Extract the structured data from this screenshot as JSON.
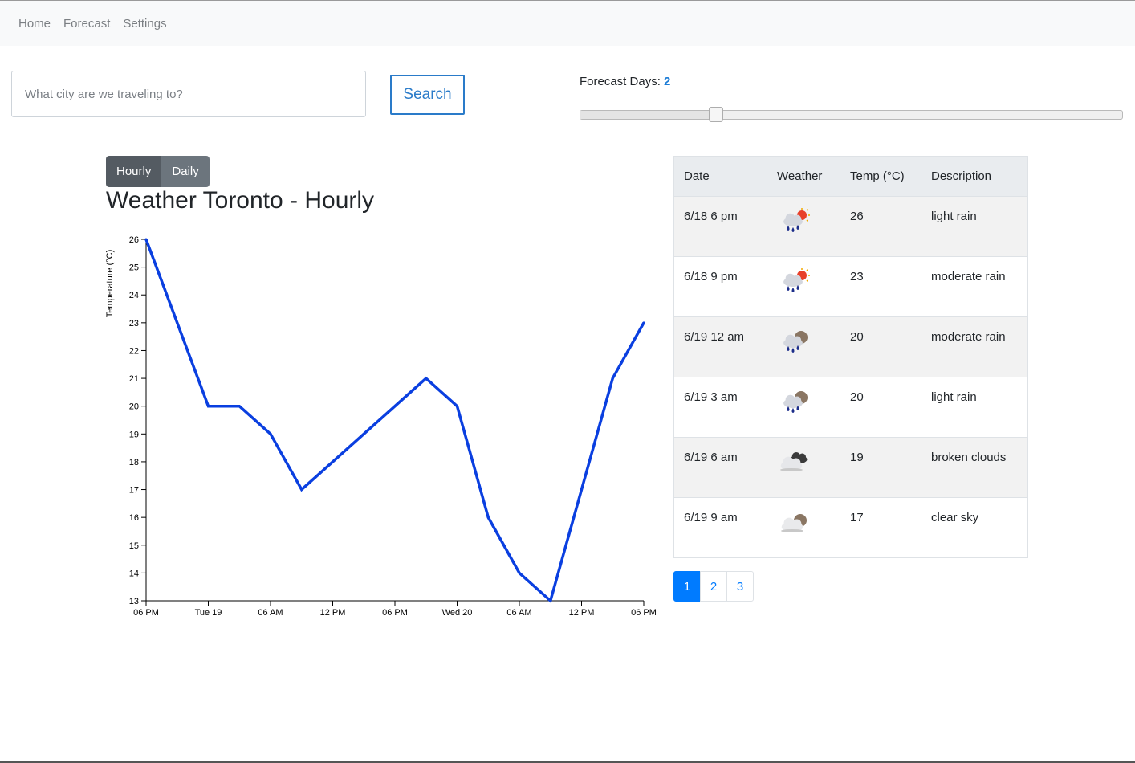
{
  "nav": {
    "items": [
      {
        "label": "Home"
      },
      {
        "label": "Forecast"
      },
      {
        "label": "Settings"
      }
    ]
  },
  "search": {
    "placeholder": "What city are we traveling to?",
    "value": "",
    "button_label": "Search"
  },
  "forecast_days": {
    "label": "Forecast Days: ",
    "value": "2",
    "slider_fraction": 0.25
  },
  "view_toggle": {
    "hourly_label": "Hourly",
    "daily_label": "Daily",
    "active": "hourly"
  },
  "chart_title": "Weather Toronto - Hourly",
  "chart_data": {
    "type": "line",
    "title": "Weather Toronto - Hourly",
    "xlabel": "",
    "ylabel": "Temperature (°C)",
    "x_ticks": [
      "06 PM",
      "Tue 19",
      "06 AM",
      "12 PM",
      "06 PM",
      "Wed 20",
      "06 AM",
      "12 PM",
      "06 PM"
    ],
    "x": [
      "6/18 6 pm",
      "6/18 9 pm",
      "6/19 12 am",
      "6/19 3 am",
      "6/19 6 am",
      "6/19 9 am",
      "6/19 12 pm",
      "6/19 3 pm",
      "6/19 6 pm",
      "6/19 9 pm",
      "6/20 12 am",
      "6/20 3 am",
      "6/20 6 am",
      "6/20 9 am",
      "6/20 12 pm",
      "6/20 3 pm",
      "6/20 6 pm"
    ],
    "series": [
      {
        "values": [
          26,
          23,
          20,
          20,
          19,
          17,
          18,
          19,
          20,
          21,
          20,
          16,
          14,
          13,
          17,
          21,
          23
        ]
      }
    ],
    "ylim": [
      13,
      26
    ],
    "y_ticks": [
      13,
      14,
      15,
      16,
      17,
      18,
      19,
      20,
      21,
      22,
      23,
      24,
      25,
      26
    ],
    "color": "#0a3fe0",
    "grid": false
  },
  "table": {
    "headers": [
      "Date",
      "Weather",
      "Temp (°C)",
      "Description"
    ],
    "rows": [
      {
        "date": "6/18 6 pm",
        "icon": "rain-sun-icon",
        "temp": "26",
        "description": "light rain"
      },
      {
        "date": "6/18 9 pm",
        "icon": "rain-sun-icon",
        "temp": "23",
        "description": "moderate rain"
      },
      {
        "date": "6/19 12 am",
        "icon": "rain-moon-icon",
        "temp": "20",
        "description": "moderate rain"
      },
      {
        "date": "6/19 3 am",
        "icon": "rain-moon-icon",
        "temp": "20",
        "description": "light rain"
      },
      {
        "date": "6/19 6 am",
        "icon": "broken-clouds-icon",
        "temp": "19",
        "description": "broken clouds"
      },
      {
        "date": "6/19 9 am",
        "icon": "clear-night-icon",
        "temp": "17",
        "description": "clear sky"
      }
    ]
  },
  "pagination": {
    "pages": [
      "1",
      "2",
      "3"
    ],
    "active": "1"
  }
}
